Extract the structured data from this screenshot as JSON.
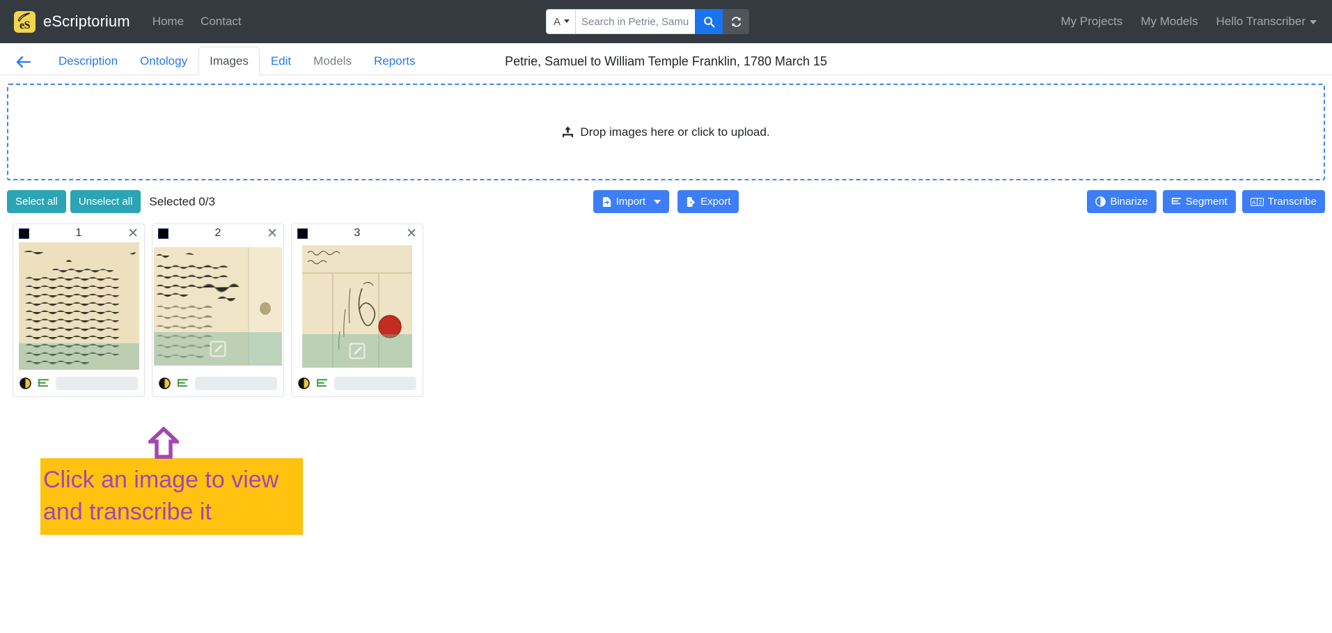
{
  "navbar": {
    "brand": "eScriptorium",
    "logo_text": "eS",
    "links": [
      {
        "label": "Home"
      },
      {
        "label": "Contact"
      }
    ],
    "search": {
      "scope_value": "A",
      "scope_options": [
        "A"
      ],
      "placeholder": "Search in Petrie, Samuel to",
      "value": "",
      "search_icon": "search-icon",
      "refresh_icon": "refresh-icon"
    },
    "right_links": [
      {
        "label": "My Projects"
      },
      {
        "label": "My Models"
      }
    ],
    "user_menu": "Hello Transcriber"
  },
  "tabbar": {
    "back_icon": "arrow-left-icon",
    "tabs": [
      {
        "label": "Description",
        "state": "link"
      },
      {
        "label": "Ontology",
        "state": "link"
      },
      {
        "label": "Images",
        "state": "active"
      },
      {
        "label": "Edit",
        "state": "link"
      },
      {
        "label": "Models",
        "state": "disabled"
      },
      {
        "label": "Reports",
        "state": "link"
      }
    ],
    "title": "Petrie, Samuel to William Temple Franklin, 1780 March 15"
  },
  "dropzone": {
    "icon": "upload-icon",
    "label": "Drop images here or click to upload."
  },
  "toolbar": {
    "select_all": "Select all",
    "unselect_all": "Unselect all",
    "selected_status": "Selected 0/3",
    "import_label": "Import",
    "import_icon": "import-icon",
    "export_label": "Export",
    "export_icon": "export-icon",
    "binarize_label": "Binarize",
    "binarize_icon": "contrast-icon",
    "segment_label": "Segment",
    "segment_icon": "lines-icon",
    "transcribe_label": "Transcribe",
    "transcribe_icon": "az-icon"
  },
  "cards": [
    {
      "number": "1",
      "checked": true,
      "close_icon": "close-icon",
      "binarize_icon": "contrast-icon",
      "segment_icon": "lines-icon",
      "has_edit_overlay": false,
      "thumb_kind": "manuscript-dense-text"
    },
    {
      "number": "2",
      "checked": true,
      "close_icon": "close-icon",
      "binarize_icon": "contrast-icon",
      "segment_icon": "lines-icon",
      "has_edit_overlay": true,
      "edit_icon": "edit-square-icon",
      "thumb_kind": "manuscript-with-signature"
    },
    {
      "number": "3",
      "checked": true,
      "close_icon": "close-icon",
      "binarize_icon": "contrast-icon",
      "segment_icon": "lines-icon",
      "has_edit_overlay": true,
      "edit_icon": "edit-square-icon",
      "thumb_kind": "letter-with-wax-seal"
    }
  ],
  "annotation": {
    "arrow_icon": "arrow-up-outline-icon",
    "line1": "Click an image to view",
    "line2": "and transcribe it",
    "highlight_color": "#ffc20e",
    "text_color": "#a347b0"
  }
}
